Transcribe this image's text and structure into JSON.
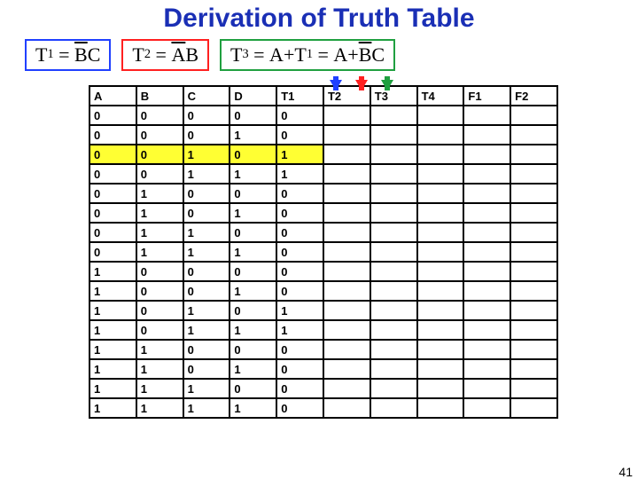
{
  "title": "Derivation of Truth Table",
  "formulas": {
    "t1": {
      "lhs": "T",
      "sub": "1",
      "rhs_overline": "B",
      "rhs_tail": "C"
    },
    "t2": {
      "lhs": "T",
      "sub": "2",
      "rhs_overline": "A",
      "rhs_tail": "B"
    },
    "t3": {
      "lhs": "T",
      "sub": "3",
      "eq1a": "A",
      "eq1b_lhs": "T",
      "eq1b_sub": "1",
      "eq2a": "A",
      "eq2b_ov": "B",
      "eq2b_tail": "C"
    }
  },
  "headers": [
    "A",
    "B",
    "C",
    "D",
    "T1",
    "T2",
    "T3",
    "T4",
    "F1",
    "F2"
  ],
  "rows": [
    {
      "hl": false,
      "cells": [
        "0",
        "0",
        "0",
        "0",
        "0",
        "",
        "",
        "",
        "",
        ""
      ]
    },
    {
      "hl": false,
      "cells": [
        "0",
        "0",
        "0",
        "1",
        "0",
        "",
        "",
        "",
        "",
        ""
      ]
    },
    {
      "hl": true,
      "cells": [
        "0",
        "0",
        "1",
        "0",
        "1",
        "",
        "",
        "",
        "",
        ""
      ]
    },
    {
      "hl": false,
      "cells": [
        "0",
        "0",
        "1",
        "1",
        "1",
        "",
        "",
        "",
        "",
        ""
      ]
    },
    {
      "hl": false,
      "cells": [
        "0",
        "1",
        "0",
        "0",
        "0",
        "",
        "",
        "",
        "",
        ""
      ]
    },
    {
      "hl": false,
      "cells": [
        "0",
        "1",
        "0",
        "1",
        "0",
        "",
        "",
        "",
        "",
        ""
      ]
    },
    {
      "hl": false,
      "cells": [
        "0",
        "1",
        "1",
        "0",
        "0",
        "",
        "",
        "",
        "",
        ""
      ]
    },
    {
      "hl": false,
      "cells": [
        "0",
        "1",
        "1",
        "1",
        "0",
        "",
        "",
        "",
        "",
        ""
      ]
    },
    {
      "hl": false,
      "cells": [
        "1",
        "0",
        "0",
        "0",
        "0",
        "",
        "",
        "",
        "",
        ""
      ]
    },
    {
      "hl": false,
      "cells": [
        "1",
        "0",
        "0",
        "1",
        "0",
        "",
        "",
        "",
        "",
        ""
      ]
    },
    {
      "hl": false,
      "cells": [
        "1",
        "0",
        "1",
        "0",
        "1",
        "",
        "",
        "",
        "",
        ""
      ]
    },
    {
      "hl": false,
      "cells": [
        "1",
        "0",
        "1",
        "1",
        "1",
        "",
        "",
        "",
        "",
        ""
      ]
    },
    {
      "hl": false,
      "cells": [
        "1",
        "1",
        "0",
        "0",
        "0",
        "",
        "",
        "",
        "",
        ""
      ]
    },
    {
      "hl": false,
      "cells": [
        "1",
        "1",
        "0",
        "1",
        "0",
        "",
        "",
        "",
        "",
        ""
      ]
    },
    {
      "hl": false,
      "cells": [
        "1",
        "1",
        "1",
        "0",
        "0",
        "",
        "",
        "",
        "",
        ""
      ]
    },
    {
      "hl": false,
      "cells": [
        "1",
        "1",
        "1",
        "1",
        "0",
        "",
        "",
        "",
        "",
        ""
      ]
    }
  ],
  "page_number": "41",
  "chart_data": {
    "type": "table",
    "title": "Derivation of Truth Table",
    "columns": [
      "A",
      "B",
      "C",
      "D",
      "T1",
      "T2",
      "T3",
      "T4",
      "F1",
      "F2"
    ],
    "rows": [
      [
        0,
        0,
        0,
        0,
        0,
        null,
        null,
        null,
        null,
        null
      ],
      [
        0,
        0,
        0,
        1,
        0,
        null,
        null,
        null,
        null,
        null
      ],
      [
        0,
        0,
        1,
        0,
        1,
        null,
        null,
        null,
        null,
        null
      ],
      [
        0,
        0,
        1,
        1,
        1,
        null,
        null,
        null,
        null,
        null
      ],
      [
        0,
        1,
        0,
        0,
        0,
        null,
        null,
        null,
        null,
        null
      ],
      [
        0,
        1,
        0,
        1,
        0,
        null,
        null,
        null,
        null,
        null
      ],
      [
        0,
        1,
        1,
        0,
        0,
        null,
        null,
        null,
        null,
        null
      ],
      [
        0,
        1,
        1,
        1,
        0,
        null,
        null,
        null,
        null,
        null
      ],
      [
        1,
        0,
        0,
        0,
        0,
        null,
        null,
        null,
        null,
        null
      ],
      [
        1,
        0,
        0,
        1,
        0,
        null,
        null,
        null,
        null,
        null
      ],
      [
        1,
        0,
        1,
        0,
        1,
        null,
        null,
        null,
        null,
        null
      ],
      [
        1,
        0,
        1,
        1,
        1,
        null,
        null,
        null,
        null,
        null
      ],
      [
        1,
        1,
        0,
        0,
        0,
        null,
        null,
        null,
        null,
        null
      ],
      [
        1,
        1,
        0,
        1,
        0,
        null,
        null,
        null,
        null,
        null
      ],
      [
        1,
        1,
        1,
        0,
        0,
        null,
        null,
        null,
        null,
        null
      ],
      [
        1,
        1,
        1,
        1,
        0,
        null,
        null,
        null,
        null,
        null
      ]
    ],
    "highlighted_row_index": 2,
    "highlighted_columns": [
      "A",
      "B",
      "C",
      "D",
      "T1"
    ]
  }
}
